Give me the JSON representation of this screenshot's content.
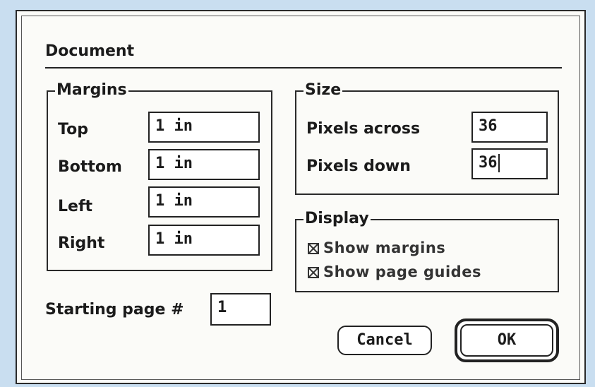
{
  "dialog": {
    "title": "Document"
  },
  "margins": {
    "label": "Margins",
    "rows": [
      {
        "label": "Top",
        "value": "1 in"
      },
      {
        "label": "Bottom",
        "value": "1 in"
      },
      {
        "label": "Left",
        "value": "1 in"
      },
      {
        "label": "Right",
        "value": "1 in"
      }
    ]
  },
  "size": {
    "label": "Size",
    "pixels_across_label": "Pixels across",
    "pixels_across_value": "36",
    "pixels_down_label": "Pixels down",
    "pixels_down_value": "36"
  },
  "display": {
    "label": "Display",
    "show_margins_label": "Show margins",
    "show_margins_checked": true,
    "show_page_guides_label": "Show page guides",
    "show_page_guides_checked": true
  },
  "starting_page": {
    "label": "Starting page #",
    "value": "1"
  },
  "buttons": {
    "cancel": "Cancel",
    "ok": "OK"
  }
}
